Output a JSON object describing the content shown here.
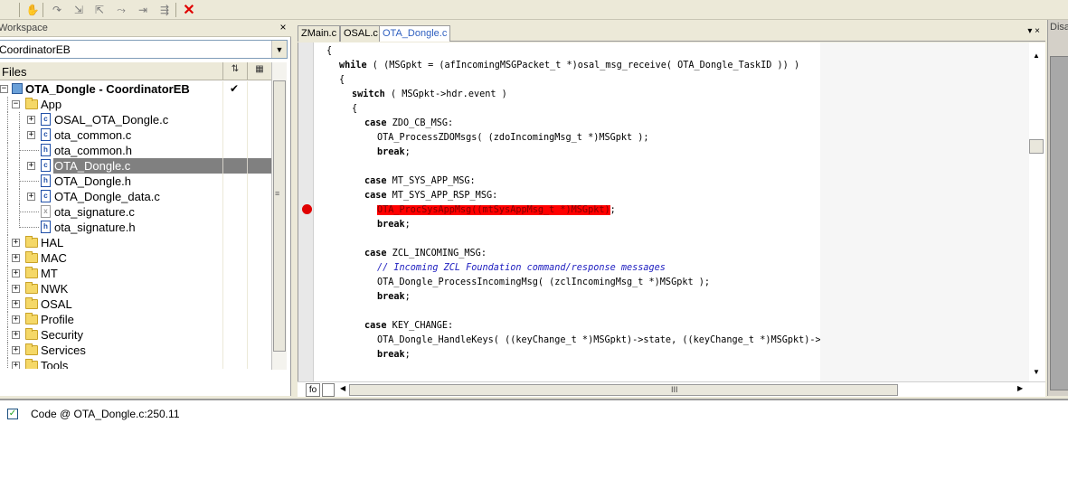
{
  "toolbar": {
    "buttons": [
      {
        "name": "halt-icon",
        "glyph": "✋"
      },
      {
        "name": "step-over-icon",
        "glyph": "↷"
      },
      {
        "name": "step-into-icon",
        "glyph": "⇲"
      },
      {
        "name": "step-out-icon",
        "glyph": "⇱"
      },
      {
        "name": "next-statement-icon",
        "glyph": "⤳"
      },
      {
        "name": "run-to-cursor-icon",
        "glyph": "⇥"
      },
      {
        "name": "go-icon",
        "glyph": "⇶"
      },
      {
        "name": "stop-debug-icon",
        "glyph": "✕"
      }
    ]
  },
  "workspace": {
    "title": "Workspace",
    "close": "×",
    "config": "CoordinatorEB",
    "files_label": "Files",
    "tree": [
      {
        "level": 0,
        "type": "project",
        "label": "OTA_Dongle - CoordinatorEB",
        "expander": "−",
        "checked": "✔"
      },
      {
        "level": 1,
        "type": "folder",
        "label": "App",
        "expander": "−"
      },
      {
        "level": 2,
        "type": "cfile",
        "label": "OSAL_OTA_Dongle.c",
        "expander": "+"
      },
      {
        "level": 2,
        "type": "cfile",
        "label": "ota_common.c",
        "expander": "+"
      },
      {
        "level": 2,
        "type": "hfile",
        "label": "ota_common.h",
        "expander": ""
      },
      {
        "level": 2,
        "type": "cfile",
        "label": "OTA_Dongle.c",
        "expander": "+",
        "selected": true
      },
      {
        "level": 2,
        "type": "hfile",
        "label": "OTA_Dongle.h",
        "expander": ""
      },
      {
        "level": 2,
        "type": "cfile",
        "label": "OTA_Dongle_data.c",
        "expander": "+"
      },
      {
        "level": 2,
        "type": "xfile",
        "label": "ota_signature.c",
        "expander": ""
      },
      {
        "level": 2,
        "type": "hfile",
        "label": "ota_signature.h",
        "expander": ""
      },
      {
        "level": 1,
        "type": "folder",
        "label": "HAL",
        "expander": "+"
      },
      {
        "level": 1,
        "type": "folder",
        "label": "MAC",
        "expander": "+"
      },
      {
        "level": 1,
        "type": "folder",
        "label": "MT",
        "expander": "+"
      },
      {
        "level": 1,
        "type": "folder",
        "label": "NWK",
        "expander": "+"
      },
      {
        "level": 1,
        "type": "folder",
        "label": "OSAL",
        "expander": "+"
      },
      {
        "level": 1,
        "type": "folder",
        "label": "Profile",
        "expander": "+"
      },
      {
        "level": 1,
        "type": "folder",
        "label": "Security",
        "expander": "+"
      },
      {
        "level": 1,
        "type": "folder",
        "label": "Services",
        "expander": "+"
      },
      {
        "level": 1,
        "type": "folder",
        "label": "Tools",
        "expander": "+"
      }
    ]
  },
  "editor": {
    "tabs": [
      {
        "label": "ZMain.c",
        "active": false
      },
      {
        "label": "OSAL.c",
        "active": false
      },
      {
        "label": "OTA_Dongle.c",
        "active": true
      }
    ],
    "tab_controls": "▾ ×",
    "lines": [
      {
        "indent": 0,
        "parts": [
          {
            "t": "{",
            "c": ""
          }
        ]
      },
      {
        "indent": 1,
        "parts": [
          {
            "t": "while",
            "c": "kw"
          },
          {
            "t": " ( (MSGpkt = (afIncomingMSGPacket_t *)osal_msg_receive( OTA_Dongle_TaskID )) )",
            "c": ""
          }
        ]
      },
      {
        "indent": 1,
        "parts": [
          {
            "t": "{",
            "c": ""
          }
        ]
      },
      {
        "indent": 2,
        "parts": [
          {
            "t": "switch",
            "c": "kw"
          },
          {
            "t": " ( MSGpkt->hdr.event )",
            "c": ""
          }
        ]
      },
      {
        "indent": 2,
        "parts": [
          {
            "t": "{",
            "c": ""
          }
        ]
      },
      {
        "indent": 3,
        "parts": [
          {
            "t": "case",
            "c": "kw"
          },
          {
            "t": " ZDO_CB_MSG:",
            "c": ""
          }
        ]
      },
      {
        "indent": 4,
        "parts": [
          {
            "t": "OTA_ProcessZDOMsgs( (zdoIncomingMsg_t *)MSGpkt );",
            "c": ""
          }
        ]
      },
      {
        "indent": 4,
        "parts": [
          {
            "t": "break",
            "c": "kw"
          },
          {
            "t": ";",
            "c": ""
          }
        ]
      },
      {
        "indent": 0,
        "parts": []
      },
      {
        "indent": 3,
        "parts": [
          {
            "t": "case",
            "c": "kw"
          },
          {
            "t": " MT_SYS_APP_MSG:",
            "c": ""
          }
        ]
      },
      {
        "indent": 3,
        "parts": [
          {
            "t": "case",
            "c": "kw"
          },
          {
            "t": " MT_SYS_APP_RSP_MSG:",
            "c": ""
          }
        ]
      },
      {
        "indent": 4,
        "parts": [
          {
            "t": "OTA_ProcSysAppMsg((mtSysAppMsg_t *)MSGpkt)",
            "c": "hl"
          },
          {
            "t": ";",
            "c": ""
          }
        ]
      },
      {
        "indent": 4,
        "parts": [
          {
            "t": "break",
            "c": "kw"
          },
          {
            "t": ";",
            "c": ""
          }
        ]
      },
      {
        "indent": 0,
        "parts": []
      },
      {
        "indent": 3,
        "parts": [
          {
            "t": "case",
            "c": "kw"
          },
          {
            "t": " ZCL_INCOMING_MSG:",
            "c": ""
          }
        ]
      },
      {
        "indent": 4,
        "parts": [
          {
            "t": "// Incoming ZCL Foundation command/response messages",
            "c": "cm"
          }
        ]
      },
      {
        "indent": 4,
        "parts": [
          {
            "t": "OTA_Dongle_ProcessIncomingMsg( (zclIncomingMsg_t *)MSGpkt );",
            "c": ""
          }
        ]
      },
      {
        "indent": 4,
        "parts": [
          {
            "t": "break",
            "c": "kw"
          },
          {
            "t": ";",
            "c": ""
          }
        ]
      },
      {
        "indent": 0,
        "parts": []
      },
      {
        "indent": 3,
        "parts": [
          {
            "t": "case",
            "c": "kw"
          },
          {
            "t": " KEY_CHANGE:",
            "c": ""
          }
        ]
      },
      {
        "indent": 4,
        "parts": [
          {
            "t": "OTA_Dongle_HandleKeys( ((keyChange_t *)MSGpkt)->state, ((keyChange_t *)MSGpkt)->keys );",
            "c": ""
          }
        ]
      },
      {
        "indent": 4,
        "parts": [
          {
            "t": "break",
            "c": "kw"
          },
          {
            "t": ";",
            "c": ""
          }
        ]
      }
    ],
    "fo_label": "fo",
    "scroll_up": "▲",
    "scroll_down": "▼",
    "scroll_left": "◀",
    "scroll_right": "▶",
    "h_grip": "III",
    "v_grip": "≡"
  },
  "right_panel": {
    "title": "Disassembly"
  },
  "breakpoints": {
    "items": [
      {
        "checked": true,
        "label": "Code @ OTA_Dongle.c:250.11"
      }
    ]
  }
}
